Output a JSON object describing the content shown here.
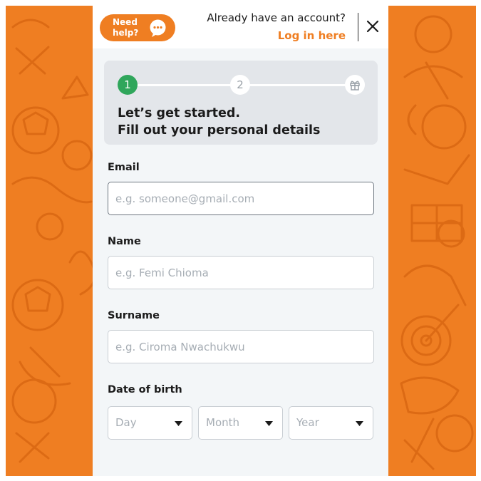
{
  "colors": {
    "brand_orange": "#ef7e22",
    "step_done_green": "#2fa65b",
    "panel_bg": "#f3f6f8",
    "card_bg": "#e3e6ea"
  },
  "header": {
    "help_label": "Need\nhelp?",
    "help_icon": "chat-bubble-icon",
    "account_prompt": "Already have an account?",
    "login_link": "Log in here",
    "close_icon": "close-icon"
  },
  "progress": {
    "steps": [
      "1",
      "2"
    ],
    "final_step_icon": "gift-icon",
    "current_step": 1,
    "title_line1": "Let’s get started.",
    "title_line2": "Fill out your personal details"
  },
  "form": {
    "email": {
      "label": "Email",
      "placeholder": "e.g. someone@gmail.com",
      "value": ""
    },
    "name": {
      "label": "Name",
      "placeholder": "e.g. Femi Chioma",
      "value": ""
    },
    "surname": {
      "label": "Surname",
      "placeholder": "e.g. Ciroma Nwachukwu",
      "value": ""
    },
    "dob": {
      "label": "Date of birth",
      "day": "Day",
      "month": "Month",
      "year": "Year",
      "caret_icon": "caret-down-icon"
    }
  }
}
